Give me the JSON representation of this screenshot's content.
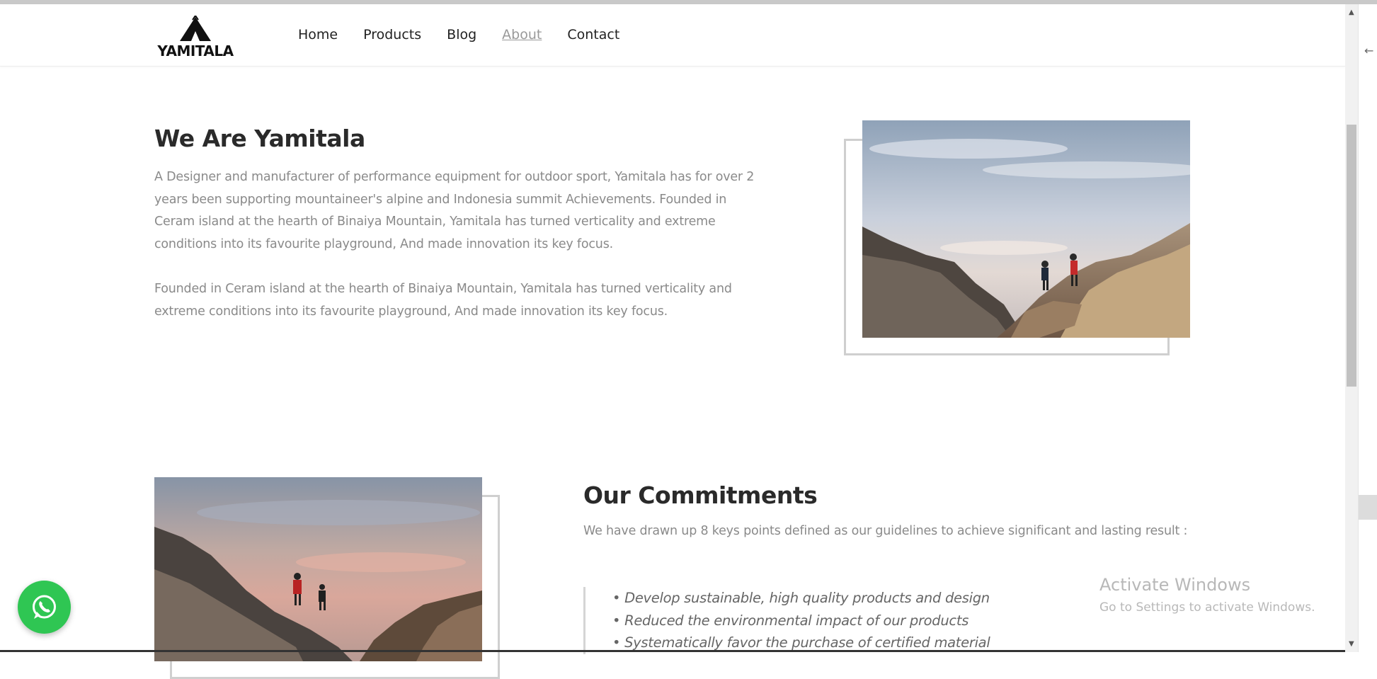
{
  "brand": {
    "name": "YAMITALA"
  },
  "nav": {
    "items": [
      {
        "label": "Home"
      },
      {
        "label": "Products"
      },
      {
        "label": "Blog"
      },
      {
        "label": "About"
      },
      {
        "label": "Contact"
      }
    ],
    "active": "About"
  },
  "about": {
    "title": "We Are Yamitala",
    "paragraph1": "A Designer and manufacturer of performance equipment for outdoor sport, Yamitala has for over 2 years been supporting mountaineer's alpine and Indonesia summit Achievements. Founded in Ceram island at the hearth of Binaiya Mountain, Yamitala has turned verticality and extreme conditions into its favourite playground, And made innovation its key focus.",
    "paragraph2": "Founded in Ceram island at the hearth of Binaiya Mountain, Yamitala has turned verticality and extreme conditions into its favourite playground, And made innovation its key focus."
  },
  "commitments": {
    "title": "Our Commitments",
    "intro": "We have drawn up 8 keys points defined as our guidelines to achieve significant and lasting result :",
    "items": [
      "• Develop sustainable, high quality products and design",
      "• Reduced the environmental impact of our products",
      "• Systematically favor the purchase of certified material"
    ]
  },
  "watermark": {
    "title": "Activate Windows",
    "subtitle": "Go to Settings to activate Windows."
  },
  "icons": {
    "whatsapp": "whatsapp-icon",
    "logo": "tent-logo-icon"
  },
  "colors": {
    "whatsapp_green": "#2fc653",
    "heading": "#2a2a2a",
    "body_text": "#8a8a8a"
  }
}
